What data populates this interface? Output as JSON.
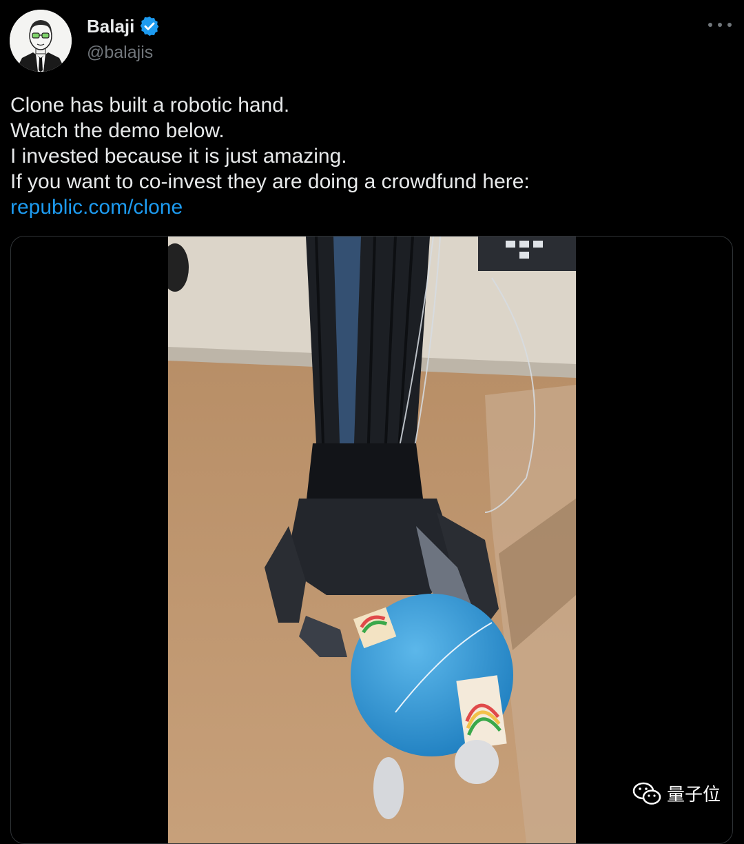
{
  "author": {
    "display_name": "Balaji",
    "handle": "@balajis",
    "verified": true,
    "avatar_icon": "sketch-portrait-avatar"
  },
  "tweet": {
    "lines": [
      "Clone has built a robotic hand.",
      "Watch the demo below.",
      "I invested because it is just amazing.",
      "If you want to co-invest they are doing a crowdfund here:"
    ],
    "link_text": "republic.com/clone"
  },
  "media": {
    "type": "video",
    "subject": "robotic-hand-holding-ball"
  },
  "watermark": {
    "label": "量子位",
    "icon": "wechat-icon"
  },
  "colors": {
    "background": "#000000",
    "text": "#e7e9ea",
    "secondary_text": "#71767b",
    "link": "#1d9bf0",
    "verified_badge": "#1d9bf0"
  }
}
